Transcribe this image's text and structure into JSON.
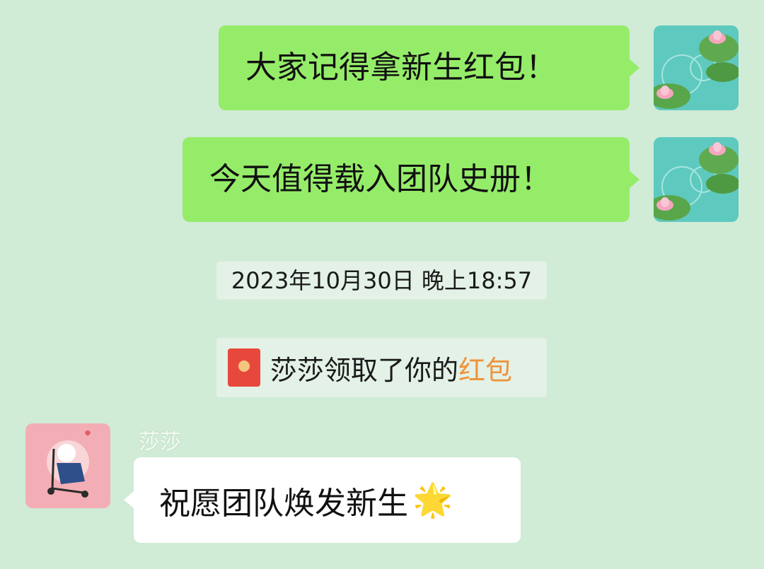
{
  "messages": [
    {
      "direction": "outgoing",
      "text": "大家记得拿新生红包！",
      "avatar_icon": "lotus-pond-avatar-icon"
    },
    {
      "direction": "outgoing",
      "text": "今天值得载入团队史册！",
      "avatar_icon": "lotus-pond-avatar-icon"
    }
  ],
  "timestamp": "2023年10月30日 晚上18:57",
  "system_notice": {
    "icon": "red-envelope-icon",
    "prefix": "莎莎领取了你的",
    "highlight": "红包",
    "highlight_color": "#f0923a"
  },
  "incoming": {
    "sender": "莎莎",
    "avatar_icon": "girl-on-scooter-avatar-icon",
    "text": "祝愿团队焕发新生",
    "emoji": "🌟",
    "emoji_icon": "glowing-star-icon"
  },
  "colors": {
    "background": "#d0ebd6",
    "outgoing_bubble": "#95ec69",
    "incoming_bubble": "#ffffff"
  }
}
